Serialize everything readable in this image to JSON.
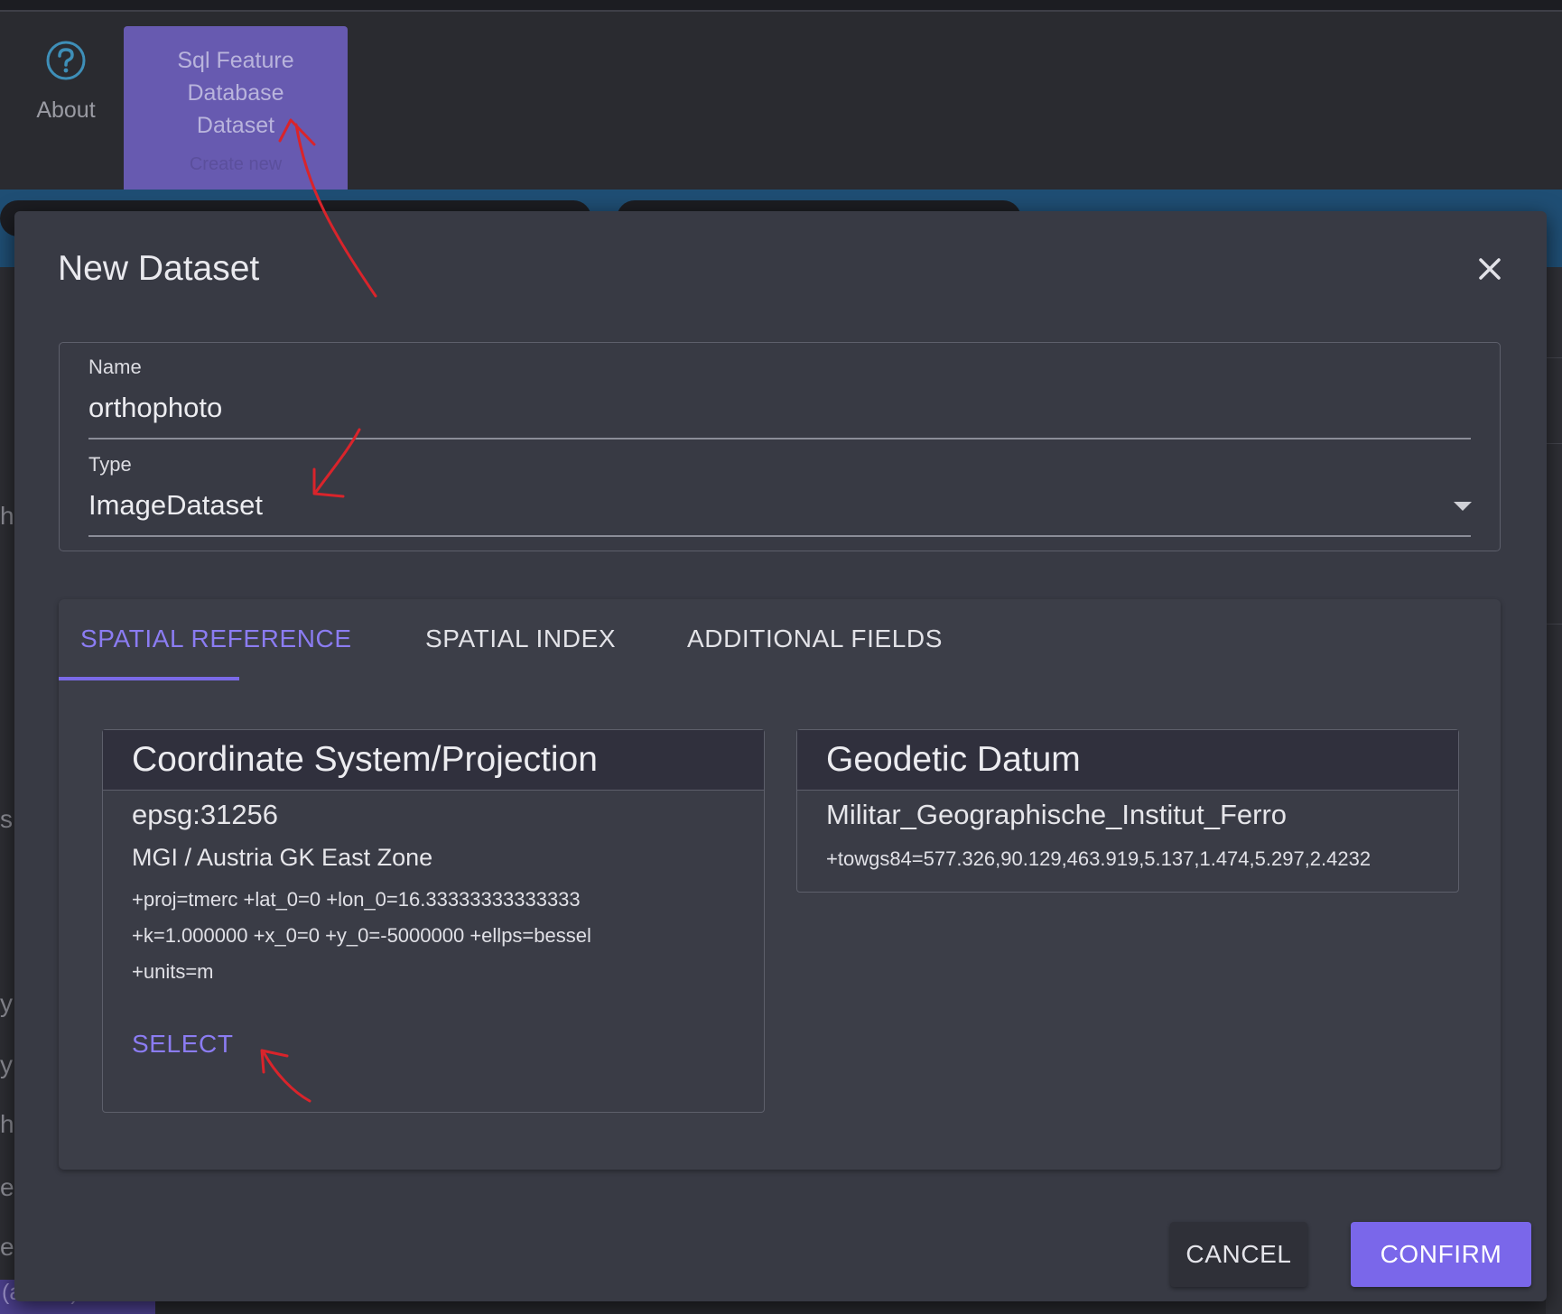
{
  "toolbar": {
    "about_label": "About",
    "sql_dataset_label": [
      "Sql Feature",
      "Database",
      "Dataset"
    ],
    "sql_dataset_sub": "Create new"
  },
  "sidebar": {
    "chars": [
      "h",
      "s",
      "y",
      "y",
      "h",
      "e",
      "e"
    ],
    "user_label": "(admin)"
  },
  "dialog": {
    "title": "New Dataset",
    "name_label": "Name",
    "name_value": "orthophoto",
    "type_label": "Type",
    "type_value": "ImageDataset",
    "tabs": [
      {
        "label": "SPATIAL REFERENCE",
        "active": true
      },
      {
        "label": "SPATIAL INDEX",
        "active": false
      },
      {
        "label": "ADDITIONAL FIELDS",
        "active": false
      }
    ],
    "coordinate_system": {
      "header": "Coordinate System/Projection",
      "code": "epsg:31256",
      "name": "MGI / Austria GK East Zone",
      "proj_lines": [
        "+proj=tmerc +lat_0=0 +lon_0=16.33333333333333",
        "+k=1.000000 +x_0=0 +y_0=-5000000 +ellps=bessel",
        "+units=m"
      ],
      "select_label": "SELECT"
    },
    "geodetic_datum": {
      "header": "Geodetic Datum",
      "name": "Militar_Geographische_Institut_Ferro",
      "towgs84": "+towgs84=577.326,90.129,463.919,5.137,1.474,5.297,2.4232"
    },
    "cancel_label": "CANCEL",
    "confirm_label": "CONFIRM"
  },
  "colors": {
    "accent": "#7a67ea",
    "tab_active": "#8b7cf2",
    "dialog_bg": "#383a44",
    "annotation": "#d9242b"
  }
}
